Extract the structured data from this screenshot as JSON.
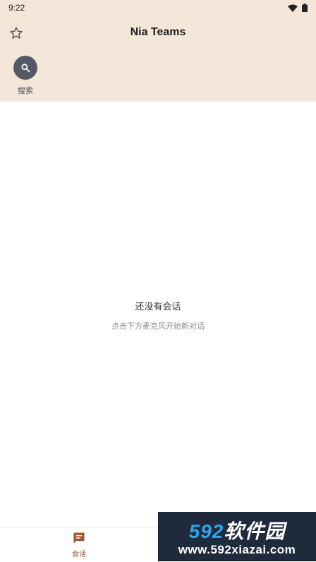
{
  "status_bar": {
    "time": "9:22"
  },
  "header": {
    "title": "Nia Teams",
    "star_icon": "star-outline-icon",
    "background": "#f5e6da"
  },
  "search": {
    "label": "搜索",
    "icon": "search-icon",
    "circle_color": "#535a66"
  },
  "empty_state": {
    "title": "还没有会话",
    "subtitle": "点击下方麦克风开始新对话"
  },
  "bottom_nav": {
    "items": [
      {
        "label": "会话",
        "icon": "chat-icon",
        "active": true
      }
    ],
    "active_color": "#a0522d"
  },
  "watermark": {
    "brand_number": "592",
    "brand_text": "软件园",
    "url": "www.592xiazai.com"
  }
}
